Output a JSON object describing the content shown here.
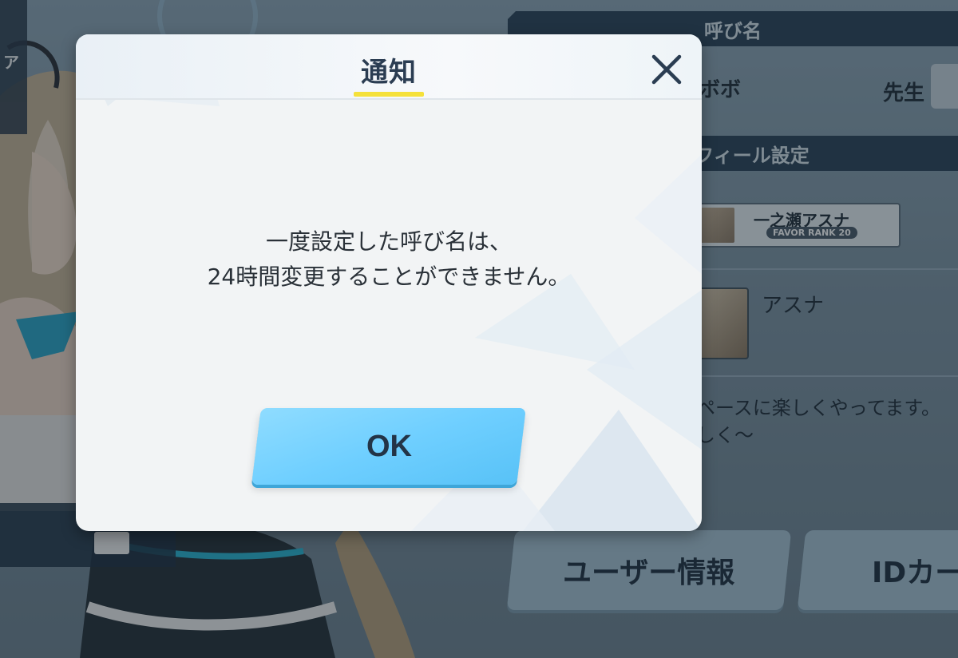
{
  "background": {
    "topleft_glyph": "ア",
    "profile": {
      "nickname_header": "呼び名",
      "nickname_value": "ボボ",
      "honorific": "先生",
      "profile_settings_header": "プロフィール設定",
      "representative_student": {
        "name": "一之瀬アスナ",
        "favor": "FAVOR RANK 20"
      },
      "assistant_name": "アスナ",
      "comment_line1": "ペースに楽しくやってます。",
      "comment_line2": "しく～"
    },
    "buttons": {
      "user_info": "ユーザー情報",
      "id_card": "IDカー"
    }
  },
  "dialog": {
    "title": "通知",
    "message_line1": "一度設定した呼び名は、",
    "message_line2": "24時間変更することができません。",
    "ok_label": "OK",
    "close_icon": "close-icon"
  },
  "colors": {
    "accent_yellow": "#f5e13a",
    "ok_button": "#6fcfff",
    "title_text": "#2b3d52"
  }
}
